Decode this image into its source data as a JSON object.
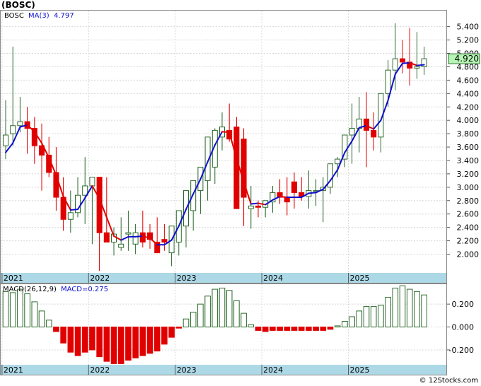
{
  "title": "(BOSC)",
  "watermark": "© 12Stocks.com",
  "colors": {
    "up_body": "#ffffff",
    "up_border": "#2e6b2e",
    "down_body": "#e00000",
    "wick": "#2e6b2e",
    "ma_up": "#1010cc",
    "ma_down": "#e00000",
    "axis_band": "#add8e6",
    "grid": "#d8d8d8",
    "macd_bar_pos": "#2e6b2e",
    "macd_bar_neg": "#e00000",
    "last_price_bg": "#b6f5b6"
  },
  "chart_data": [
    {
      "type": "candlestick",
      "legend": {
        "symbol": "BOSC",
        "ma_label": "MA(3)",
        "ma_value": "4.797"
      },
      "x_tick_labels": [
        "2021",
        "2022",
        "2023",
        "2024",
        "2025"
      ],
      "x_tick_months": [
        0,
        12,
        24,
        36,
        48
      ],
      "y_ticks": [
        2.0,
        2.2,
        2.4,
        2.6,
        2.8,
        3.0,
        3.2,
        3.4,
        3.6,
        3.8,
        4.0,
        4.2,
        4.4,
        4.6,
        4.8,
        5.0,
        5.2,
        5.4
      ],
      "y_tick_labels": [
        "2.000",
        "2.200",
        "2.400",
        "2.600",
        "2.800",
        "3.000",
        "3.200",
        "3.400",
        "3.600",
        "3.800",
        "4.000",
        "4.200",
        "4.400",
        "4.600",
        "4.800",
        "5.000",
        "5.200",
        "5.400"
      ],
      "ylim": [
        1.72,
        5.65
      ],
      "last_price": "4.920",
      "months": [
        "2021-01",
        "2021-02",
        "2021-03",
        "2021-04",
        "2021-05",
        "2021-06",
        "2021-07",
        "2021-08",
        "2021-09",
        "2021-10",
        "2021-11",
        "2021-12",
        "2022-01",
        "2022-02",
        "2022-03",
        "2022-04",
        "2022-05",
        "2022-06",
        "2022-07",
        "2022-08",
        "2022-09",
        "2022-10",
        "2022-11",
        "2022-12",
        "2023-01",
        "2023-02",
        "2023-03",
        "2023-04",
        "2023-05",
        "2023-06",
        "2023-07",
        "2023-08",
        "2023-09",
        "2023-10",
        "2023-11",
        "2023-12",
        "2024-01",
        "2024-02",
        "2024-03",
        "2024-04",
        "2024-05",
        "2024-06",
        "2024-07",
        "2024-08",
        "2024-09",
        "2024-10",
        "2024-11",
        "2024-12",
        "2025-01",
        "2025-02",
        "2025-03",
        "2025-04",
        "2025-05",
        "2025-06",
        "2025-07",
        "2025-08",
        "2025-09",
        "2025-10",
        "2025-11"
      ],
      "open": [
        3.62,
        3.8,
        3.92,
        3.98,
        3.88,
        3.62,
        3.48,
        3.22,
        2.85,
        2.52,
        2.62,
        2.88,
        3.02,
        3.15,
        2.32,
        2.18,
        2.1,
        2.3,
        2.15,
        2.32,
        2.32,
        2.18,
        2.22,
        2.02,
        2.18,
        2.42,
        2.65,
        2.95,
        3.1,
        3.3,
        3.75,
        3.85,
        3.9,
        3.72,
        2.68,
        2.72,
        2.7,
        2.78,
        2.92,
        2.85,
        3.08,
        2.92,
        2.86,
        2.95,
        2.95,
        3.0,
        3.35,
        3.42,
        3.78,
        3.88,
        4.02,
        3.85,
        3.75,
        4.4,
        4.75,
        4.92,
        4.87,
        4.78,
        4.8
      ],
      "high": [
        4.3,
        5.1,
        4.35,
        4.2,
        4.05,
        3.95,
        3.75,
        3.6,
        3.15,
        2.95,
        3.15,
        3.45,
        3.05,
        3.1,
        3.15,
        2.4,
        2.55,
        2.65,
        2.45,
        2.65,
        2.45,
        2.55,
        2.45,
        2.25,
        2.35,
        2.58,
        2.95,
        3.25,
        3.55,
        3.88,
        4.12,
        4.25,
        4.05,
        3.88,
        3.02,
        2.8,
        2.78,
        3.02,
        3.12,
        3.15,
        3.22,
        3.15,
        3.25,
        3.12,
        3.15,
        3.25,
        3.45,
        3.58,
        4.25,
        4.35,
        4.42,
        4.12,
        4.12,
        4.9,
        5.45,
        5.2,
        5.38,
        5.32,
        5.1
      ],
      "low": [
        3.42,
        3.62,
        3.82,
        3.5,
        3.35,
        2.95,
        3.15,
        2.65,
        2.35,
        2.32,
        2.55,
        2.45,
        2.15,
        1.75,
        2.2,
        1.98,
        2.05,
        2.05,
        2.0,
        2.1,
        2.08,
        2.1,
        2.05,
        1.82,
        1.98,
        2.1,
        2.35,
        2.6,
        2.8,
        3.05,
        3.55,
        3.68,
        3.6,
        2.42,
        2.38,
        2.55,
        2.55,
        2.62,
        2.75,
        2.58,
        2.68,
        2.8,
        2.68,
        2.72,
        2.48,
        2.9,
        3.15,
        3.3,
        3.35,
        3.52,
        3.3,
        3.55,
        3.52,
        4.2,
        4.45,
        4.7,
        4.52,
        4.62,
        4.68
      ],
      "close": [
        3.78,
        3.92,
        3.98,
        3.88,
        3.62,
        3.48,
        3.22,
        2.85,
        2.52,
        2.62,
        2.88,
        3.02,
        3.15,
        2.32,
        2.18,
        2.3,
        2.15,
        2.32,
        2.32,
        2.18,
        2.22,
        2.02,
        2.18,
        2.42,
        2.65,
        2.95,
        3.1,
        3.3,
        3.75,
        3.85,
        3.9,
        3.72,
        2.68,
        2.85,
        2.72,
        2.7,
        2.8,
        2.92,
        2.85,
        2.78,
        2.92,
        2.86,
        2.95,
        2.95,
        3.0,
        3.35,
        3.42,
        3.78,
        3.88,
        4.02,
        3.85,
        3.75,
        4.4,
        4.75,
        4.92,
        4.87,
        4.78,
        4.8,
        4.92
      ],
      "ma3": [
        3.52,
        3.66,
        3.9,
        3.93,
        3.83,
        3.66,
        3.44,
        3.18,
        2.86,
        2.66,
        2.67,
        2.84,
        3.02,
        2.83,
        2.55,
        2.27,
        2.21,
        2.26,
        2.26,
        2.27,
        2.24,
        2.14,
        2.14,
        2.21,
        2.42,
        2.67,
        2.9,
        3.12,
        3.38,
        3.63,
        3.83,
        3.82,
        3.43,
        3.08,
        2.75,
        2.76,
        2.74,
        2.81,
        2.86,
        2.85,
        2.85,
        2.85,
        2.91,
        2.92,
        2.97,
        3.1,
        3.26,
        3.52,
        3.69,
        3.89,
        3.92,
        3.87,
        4.0,
        4.3,
        4.69,
        4.85,
        4.86,
        4.82,
        4.83
      ]
    },
    {
      "type": "bar",
      "legend": {
        "label": "MACD(26,12,9)",
        "value_label": "MACD=0.275"
      },
      "y_ticks": [
        -0.2,
        0.0,
        0.2
      ],
      "y_tick_labels": [
        "-0.200",
        "0.000",
        "0.200"
      ],
      "ylim": [
        -0.33,
        0.38
      ],
      "values": [
        0.31,
        0.3,
        0.33,
        0.29,
        0.22,
        0.14,
        0.06,
        -0.04,
        -0.14,
        -0.22,
        -0.25,
        -0.22,
        -0.2,
        -0.26,
        -0.3,
        -0.32,
        -0.32,
        -0.29,
        -0.27,
        -0.25,
        -0.23,
        -0.21,
        -0.15,
        -0.09,
        -0.01,
        0.07,
        0.13,
        0.2,
        0.27,
        0.33,
        0.34,
        0.32,
        0.23,
        0.12,
        0.02,
        -0.03,
        -0.04,
        -0.03,
        -0.03,
        -0.03,
        -0.03,
        -0.03,
        -0.03,
        -0.03,
        -0.03,
        -0.02,
        0.01,
        0.05,
        0.09,
        0.14,
        0.18,
        0.18,
        0.19,
        0.26,
        0.34,
        0.36,
        0.33,
        0.31,
        0.28
      ]
    }
  ]
}
